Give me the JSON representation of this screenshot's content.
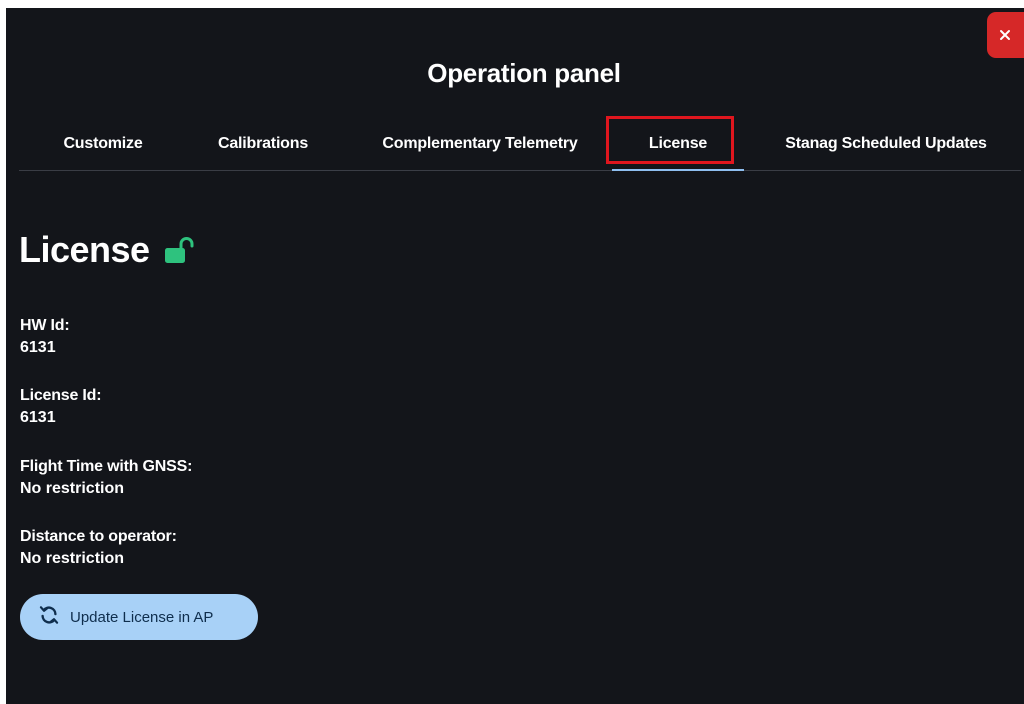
{
  "panel": {
    "title": "Operation panel",
    "close_label": "×"
  },
  "tabs": [
    {
      "label": "Customize",
      "active": false
    },
    {
      "label": "Calibrations",
      "active": false
    },
    {
      "label": "Complementary Telemetry",
      "active": false
    },
    {
      "label": "License",
      "active": true
    },
    {
      "label": "Stanag Scheduled Updates",
      "active": false
    }
  ],
  "license": {
    "heading": "License",
    "lock_icon": "unlocked-padlock-icon",
    "fields": [
      {
        "label": "HW Id:",
        "value": "6131"
      },
      {
        "label": "License Id:",
        "value": "6131"
      },
      {
        "label": "Flight Time with GNSS:",
        "value": "No restriction"
      },
      {
        "label": "Distance to operator:",
        "value": "No restriction"
      }
    ],
    "update_button": {
      "label": "Update License in AP",
      "icon": "refresh-icon"
    }
  },
  "colors": {
    "panel_bg": "#13151a",
    "close_bg": "#d62828",
    "lock_green": "#2ec27e",
    "button_bg": "#a8d1f7",
    "tab_underline": "#8fbff0",
    "highlight": "#e0161e"
  }
}
